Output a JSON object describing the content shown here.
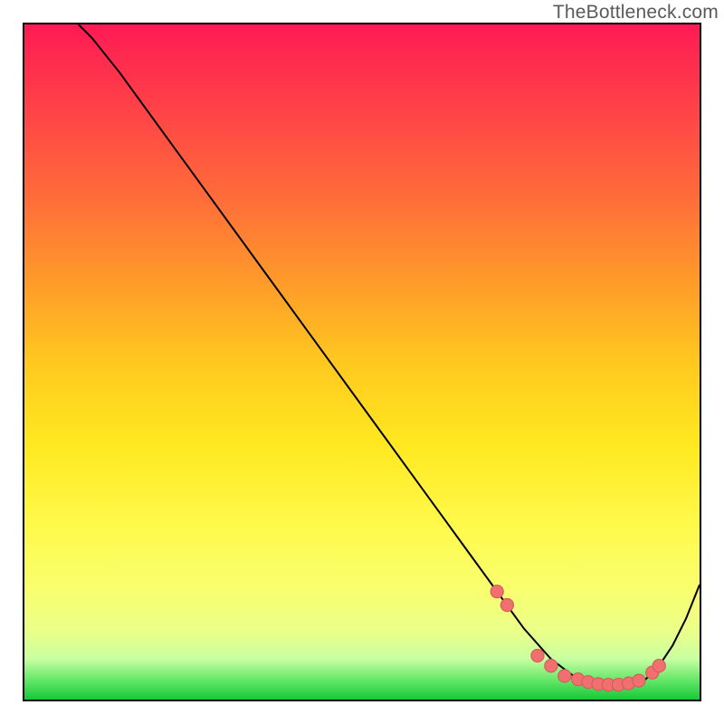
{
  "watermark": "TheBottleneck.com",
  "colors": {
    "curve_stroke": "#000000",
    "dot_fill": "#f07070",
    "dot_stroke": "#d85a5a",
    "frame": "#000000"
  },
  "chart_data": {
    "type": "line",
    "title": "",
    "xlabel": "",
    "ylabel": "",
    "xlim": [
      0,
      100
    ],
    "ylim": [
      0,
      100
    ],
    "grid": false,
    "legend": false,
    "series": [
      {
        "name": "bottleneck-curve",
        "x": [
          8,
          10,
          14,
          18,
          22,
          26,
          30,
          34,
          38,
          42,
          46,
          50,
          54,
          58,
          62,
          66,
          70,
          74,
          78,
          82,
          84,
          86,
          88,
          90,
          92,
          94,
          96,
          98,
          100
        ],
        "y": [
          100,
          98,
          93,
          87.5,
          82,
          76.5,
          71,
          65.5,
          60,
          54.5,
          49,
          43.5,
          38,
          32.5,
          27,
          21.5,
          16,
          10.5,
          6,
          3,
          2.3,
          2,
          2,
          2.3,
          3,
          5,
          8,
          12,
          17
        ]
      }
    ],
    "dots": {
      "name": "highlighted-points",
      "x": [
        70,
        71.5,
        76,
        78,
        80,
        82,
        83.5,
        85,
        86.5,
        88,
        89.5,
        91,
        93,
        94
      ],
      "y": [
        16,
        14,
        6.5,
        5,
        3.5,
        3,
        2.6,
        2.3,
        2.2,
        2.2,
        2.4,
        2.8,
        4,
        5
      ]
    }
  }
}
